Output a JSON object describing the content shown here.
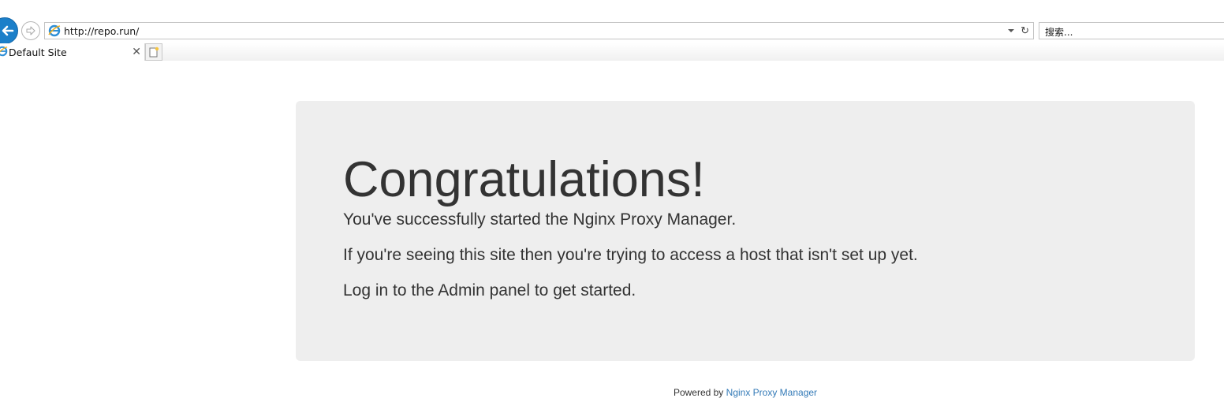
{
  "browser": {
    "address_url": "http://repo.run/",
    "search_placeholder": "搜索...",
    "tab_title": "Default Site",
    "tab_close_glyph": "✕",
    "refresh_glyph": "↻"
  },
  "page": {
    "title": "Congratulations!",
    "paragraphs": [
      "You've successfully started the Nginx Proxy Manager.",
      "If you're seeing this site then you're trying to access a host that isn't set up yet.",
      "Log in to the Admin panel to get started."
    ],
    "footer_prefix": "Powered by",
    "footer_link": "Nginx Proxy Manager"
  },
  "colors": {
    "back_button": "#1b7fc9",
    "jumbotron_bg": "#eeeeee",
    "link": "#337ab7",
    "text": "#333333"
  },
  "icons": {
    "back": "back-arrow-icon",
    "forward": "forward-arrow-icon",
    "site": "ie-icon",
    "dropdown": "chevron-down-icon",
    "refresh": "refresh-icon",
    "close": "close-icon",
    "new_tab": "new-tab-icon"
  }
}
